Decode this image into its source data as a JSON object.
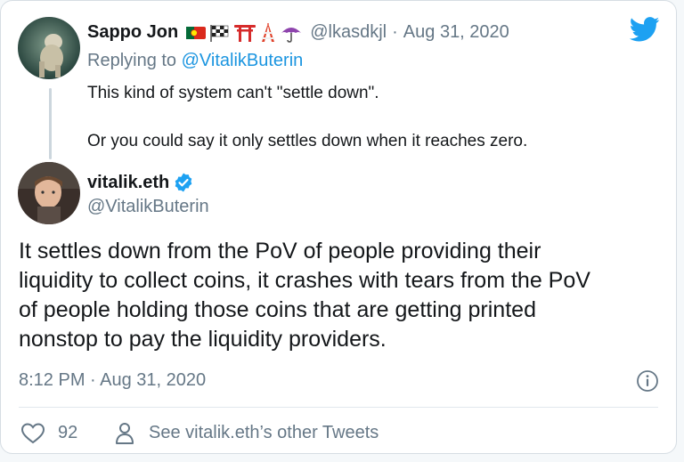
{
  "reply": {
    "author_name": "Sappo Jon",
    "emoji_icons": [
      "portugal-flag-icon",
      "checkered-flag-icon",
      "torii-gate-icon",
      "tokyo-tower-icon",
      "umbrella-icon"
    ],
    "handle": "@lkasdkjl",
    "separator": "·",
    "date": "Aug 31, 2020",
    "replying_prefix": "Replying to ",
    "replying_to": "@VitalikButerin",
    "text_line1": "This kind of system can't \"settle down\".",
    "text_line2": "Or you could say it only settles down when it reaches zero."
  },
  "tweet": {
    "author_name": "vitalik.eth",
    "verified": true,
    "handle": "@VitalikButerin",
    "lines": [
      "It settles down from the PoV of people providing their",
      "liquidity to collect coins, it crashes with tears from the PoV",
      "of people holding those coins that are getting printed",
      "nonstop to pay the liquidity providers."
    ],
    "timestamp": "8:12 PM · Aug 31, 2020"
  },
  "actions": {
    "like_count": "92",
    "other_tweets_label": "See vitalik.eth’s other Tweets"
  },
  "colors": {
    "accent": "#1b95e0",
    "muted": "#657786",
    "text": "#14171a"
  }
}
